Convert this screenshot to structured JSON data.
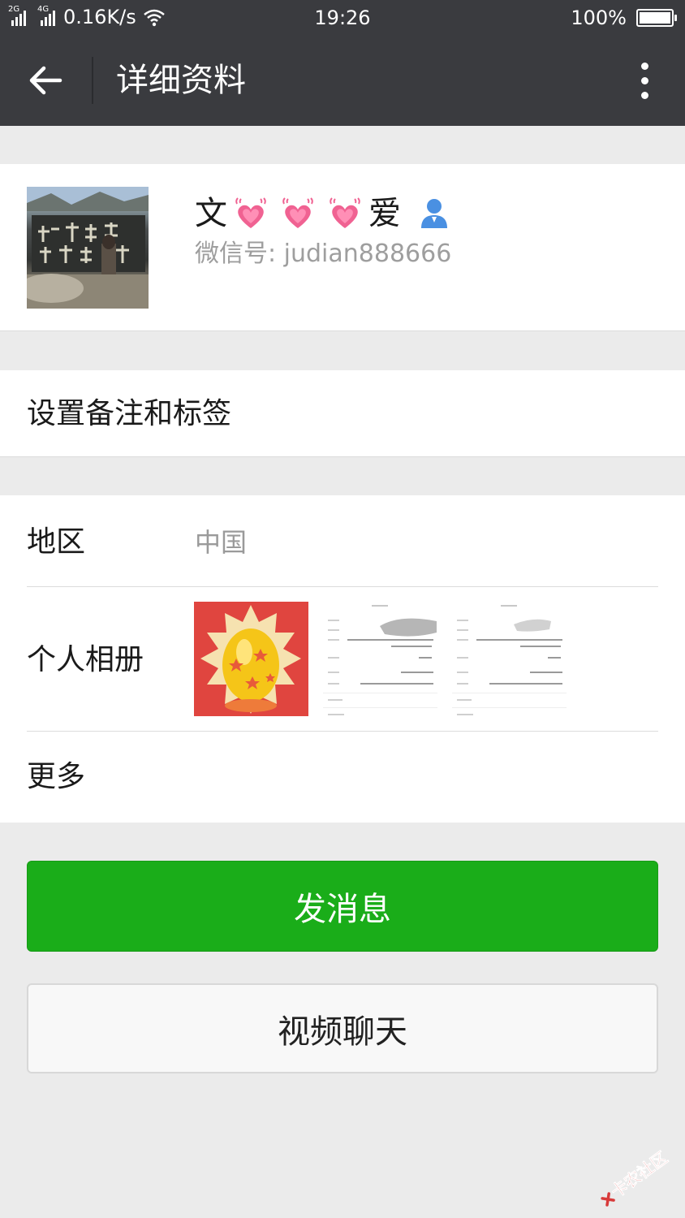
{
  "status_bar": {
    "signal_1_label": "2G",
    "signal_2_label": "4G",
    "network_speed": "0.16K/s",
    "time": "19:26",
    "battery_percent": "100%",
    "battery_level": 1.0
  },
  "header": {
    "title": "详细资料",
    "back_icon": "arrow-left-icon",
    "more_icon": "more-vertical-icon"
  },
  "profile": {
    "nickname_start": "文",
    "nickname_end": "爱",
    "emoji_icon": "beating-heart-icon",
    "emoji_count": 3,
    "contact_icon": "contact-person-icon",
    "wechat_id": "微信号: judian888666"
  },
  "remark": {
    "label": "设置备注和标签"
  },
  "details": {
    "region_label": "地区",
    "region_value": "中国",
    "album_label": "个人相册",
    "more_label": "更多"
  },
  "actions": {
    "send_message": "发消息",
    "video_chat": "视频聊天"
  },
  "watermark": {
    "text": "卡农社区"
  },
  "colors": {
    "header_bg": "#3a3b3f",
    "page_bg": "#ebebeb",
    "primary_green": "#1aad19",
    "secondary_text": "#9e9e9e",
    "watermark_red": "#d83a3a"
  }
}
